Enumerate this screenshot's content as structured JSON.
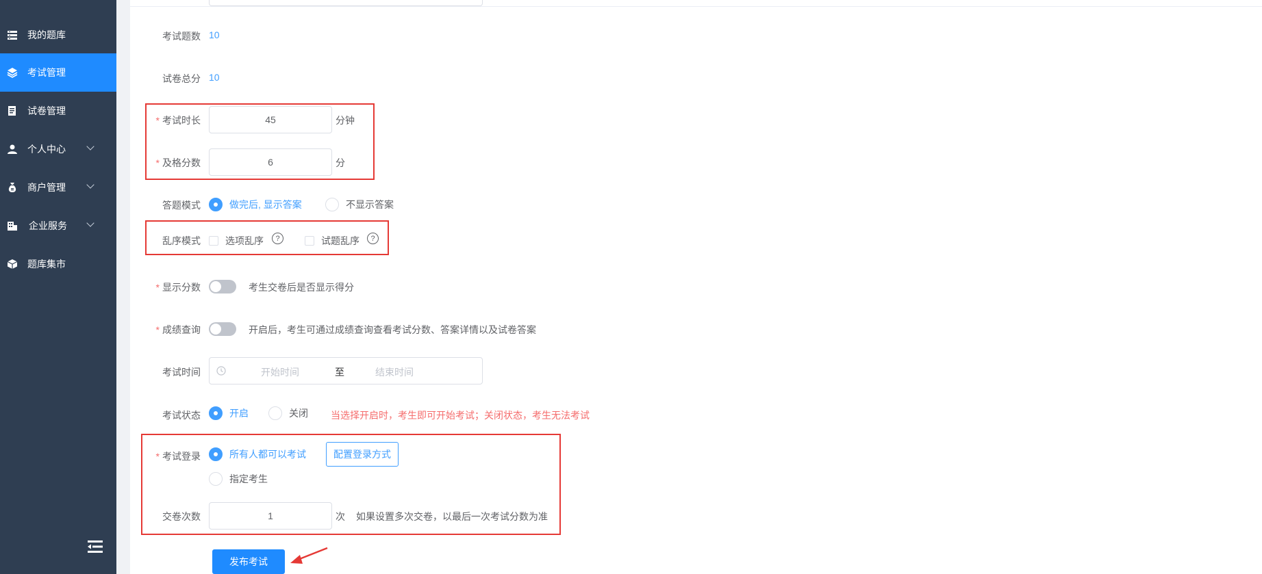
{
  "sidebar": {
    "items": [
      {
        "label": "我的题库",
        "icon": "list-icon",
        "active": false,
        "has_chevron": false
      },
      {
        "label": "考试管理",
        "icon": "layers-icon",
        "active": true,
        "has_chevron": false
      },
      {
        "label": "试卷管理",
        "icon": "document-icon",
        "active": false,
        "has_chevron": false
      },
      {
        "label": "个人中心",
        "icon": "user-icon",
        "active": false,
        "has_chevron": true
      },
      {
        "label": "商户管理",
        "icon": "money-bag-icon",
        "active": false,
        "has_chevron": true
      },
      {
        "label": "企业服务",
        "icon": "building-icon",
        "active": false,
        "has_chevron": true
      },
      {
        "label": "题库集市",
        "icon": "cube-icon",
        "active": false,
        "has_chevron": false
      }
    ],
    "collapse_icon": "collapse-menu-icon",
    "bg_color": "#2f3e52",
    "active_color": "#1f8bff"
  },
  "form": {
    "question_count": {
      "label": "考试题数",
      "value": "10"
    },
    "total_score": {
      "label": "试卷总分",
      "value": "10"
    },
    "duration": {
      "label": "考试时长",
      "required": "*",
      "value": "45",
      "unit": "分钟"
    },
    "pass_score": {
      "label": "及格分数",
      "required": "*",
      "value": "6",
      "unit": "分"
    },
    "answer_mode": {
      "label": "答题模式",
      "options": [
        "做完后, 显示答案",
        "不显示答案"
      ],
      "selected": "做完后, 显示答案"
    },
    "shuffle_mode": {
      "label": "乱序模式",
      "options": [
        "选项乱序",
        "试题乱序"
      ],
      "help_icon": "question-circle-icon"
    },
    "show_score": {
      "label": "显示分数",
      "required": "*",
      "enabled": false,
      "hint": "考生交卷后是否显示得分"
    },
    "score_query": {
      "label": "成绩查询",
      "required": "*",
      "enabled": false,
      "hint": "开启后，考生可通过成绩查询查看考试分数、答案详情以及试卷答案"
    },
    "exam_time": {
      "label": "考试时间",
      "start_placeholder": "开始时间",
      "separator": "至",
      "end_placeholder": "结束时间",
      "icon": "clock-icon"
    },
    "exam_status": {
      "label": "考试状态",
      "options": [
        "开启",
        "关闭"
      ],
      "selected": "开启",
      "hint": "当选择开启时，考生即可开始考试；关闭状态，考生无法考试"
    },
    "exam_login": {
      "label": "考试登录",
      "required": "*",
      "options": [
        "所有人都可以考试",
        "指定考生"
      ],
      "selected": "所有人都可以考试",
      "config_button": "配置登录方式"
    },
    "submit_times": {
      "label": "交卷次数",
      "value": "1",
      "unit": "次",
      "hint": "如果设置多次交卷，以最后一次考试分数为准"
    },
    "publish_button": "发布考试"
  },
  "colors": {
    "primary": "#409eff",
    "danger": "#f56c6c",
    "highlight_box": "#e53935"
  }
}
